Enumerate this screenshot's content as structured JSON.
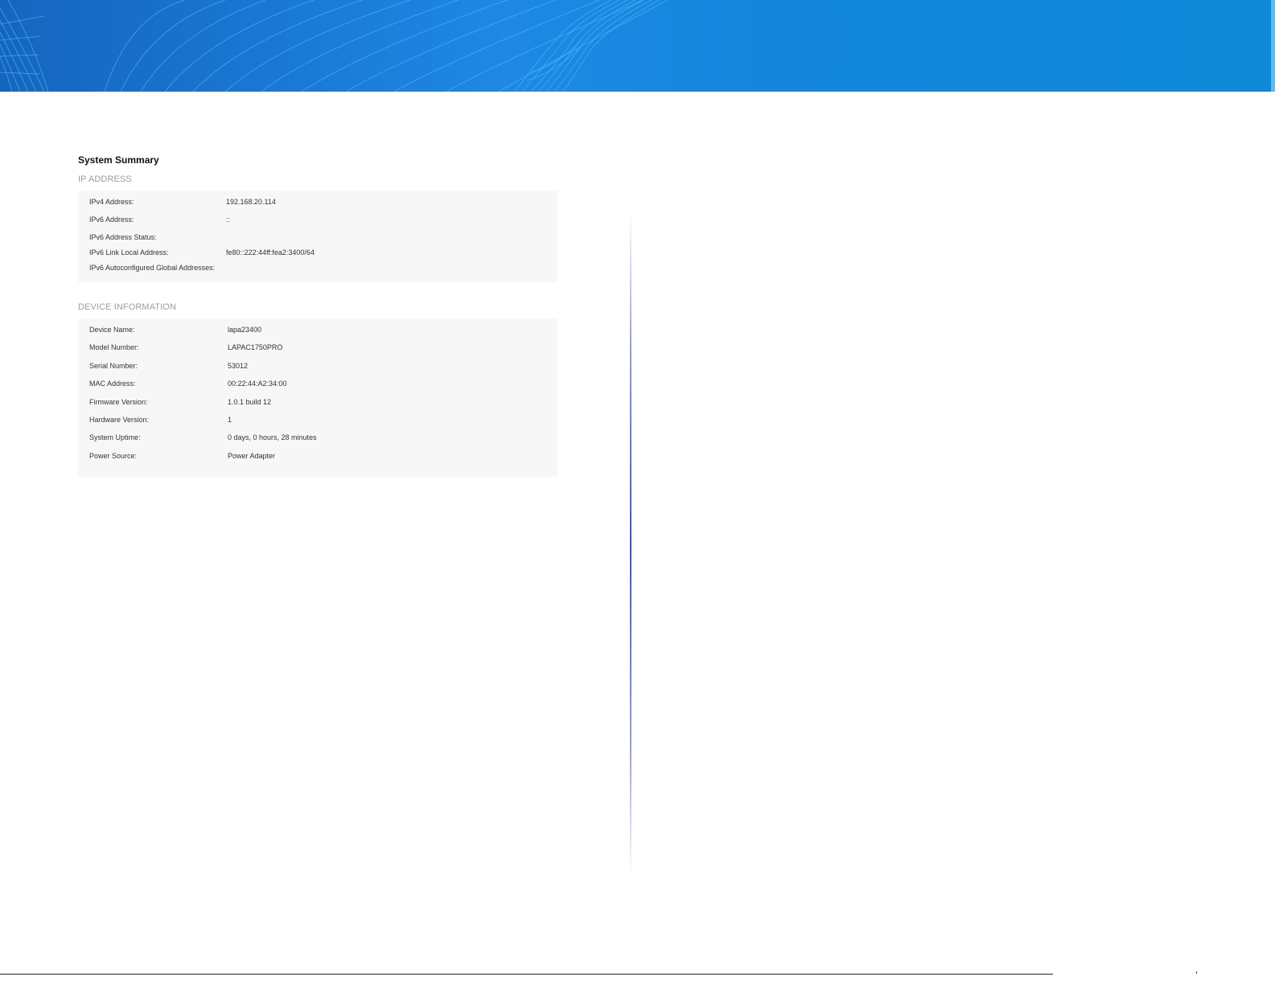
{
  "header": {
    "colors": {
      "banner_start": "#1565c0",
      "banner_end": "#0f88d8",
      "wave_lines": "#4fc3f7"
    }
  },
  "page": {
    "title": "System Summary"
  },
  "ip_address": {
    "heading": "IP ADDRESS",
    "rows": [
      {
        "label": "IPv4 Address:",
        "value": "192.168.20.114"
      },
      {
        "label": "IPv6 Address:",
        "value": "::"
      },
      {
        "label": "IPv6 Address Status:",
        "value": ""
      },
      {
        "label": "IPv6 Link Local Address:",
        "value": "fe80::222:44ff:fea2:3400/64"
      },
      {
        "label": "IPv6 Autoconfigured Global Addresses:",
        "value": ""
      }
    ]
  },
  "device_information": {
    "heading": "DEVICE INFORMATION",
    "rows": [
      {
        "label": "Device Name:",
        "value": "lapa23400"
      },
      {
        "label": "Model Number:",
        "value": "LAPAC1750PRO"
      },
      {
        "label": "Serial Number:",
        "value": "53012"
      },
      {
        "label": "MAC Address:",
        "value": "00:22:44:A2:34:00"
      },
      {
        "label": "Firmware Version:",
        "value": "1.0.1 build 12"
      },
      {
        "label": "Hardware Version:",
        "value": "1"
      },
      {
        "label": "System Uptime:",
        "value": "0 days, 0 hours, 28 minutes"
      },
      {
        "label": "Power Source:",
        "value": "Power Adapter"
      }
    ]
  },
  "divider_color": "#3f51b5"
}
